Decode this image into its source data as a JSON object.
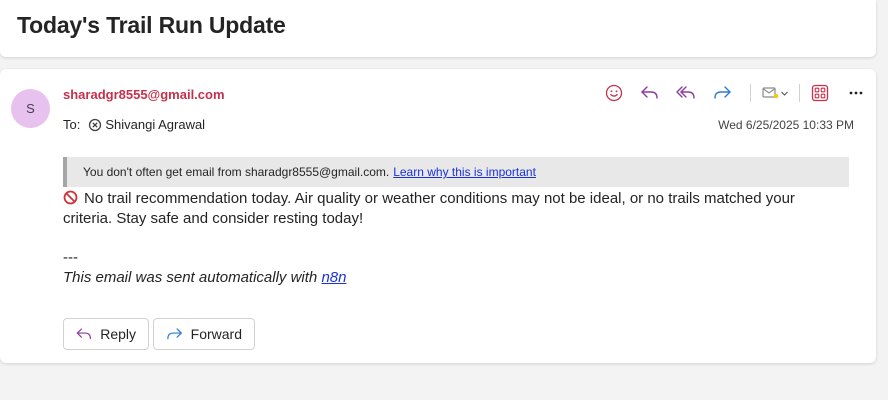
{
  "subject": "Today's Trail Run Update",
  "message": {
    "avatar_initial": "S",
    "sender": "sharadgr8555@gmail.com",
    "to_label": "To:",
    "recipient": "Shivangi Agrawal",
    "date": "Wed 6/25/2025 10:33 PM",
    "banner": {
      "text": "You don't often get email from sharadgr8555@gmail.com.",
      "link": "Learn why this is important"
    },
    "body": "No trail recommendation today. Air quality or weather conditions may not be ideal, or no trails matched your criteria. Stay safe and consider resting today!",
    "signature_dash": "---",
    "signature_text": "This email was sent automatically with ",
    "signature_link": "n8n"
  },
  "toolbar": {
    "icons": [
      "emoji-icon",
      "reply-icon",
      "reply-all-icon",
      "forward-icon",
      "actions-combo-icon",
      "apps-icon",
      "more-icon"
    ]
  },
  "actions": {
    "reply": "Reply",
    "forward": "Forward"
  },
  "colors": {
    "sender": "#c4314b",
    "accent_purple": "#8e3a9e",
    "forward_blue": "#2b7cd3",
    "link": "#1a31d9",
    "avatar_bg": "#e8c2ee"
  }
}
